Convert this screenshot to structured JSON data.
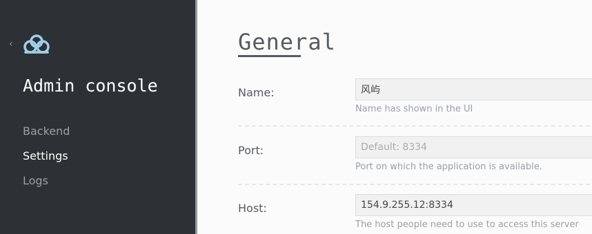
{
  "sidebar": {
    "back_icon": "chevron-left-icon",
    "logo_icon": "cloud-icon",
    "app_title": "Admin console",
    "items": [
      {
        "label": "Backend",
        "active": false
      },
      {
        "label": "Settings",
        "active": true
      },
      {
        "label": "Logs",
        "active": false
      }
    ]
  },
  "main": {
    "section_title": "General",
    "fields": [
      {
        "label": "Name:",
        "value": "风屿",
        "placeholder": "",
        "help": "Name has shown in the UI"
      },
      {
        "label": "Port:",
        "value": "",
        "placeholder": "Default: 8334",
        "help": "Port on which the application is available."
      },
      {
        "label": "Host:",
        "value": "154.9.255.12:8334",
        "placeholder": "",
        "help": "The host people need to use to access this server"
      }
    ]
  },
  "colors": {
    "sidebar_bg": "#2d3135",
    "content_bg": "#fbfbfb",
    "logo_accent": "#9fd0ea",
    "active_nav": "#ffffff",
    "inactive_nav": "#9aa0a6"
  }
}
